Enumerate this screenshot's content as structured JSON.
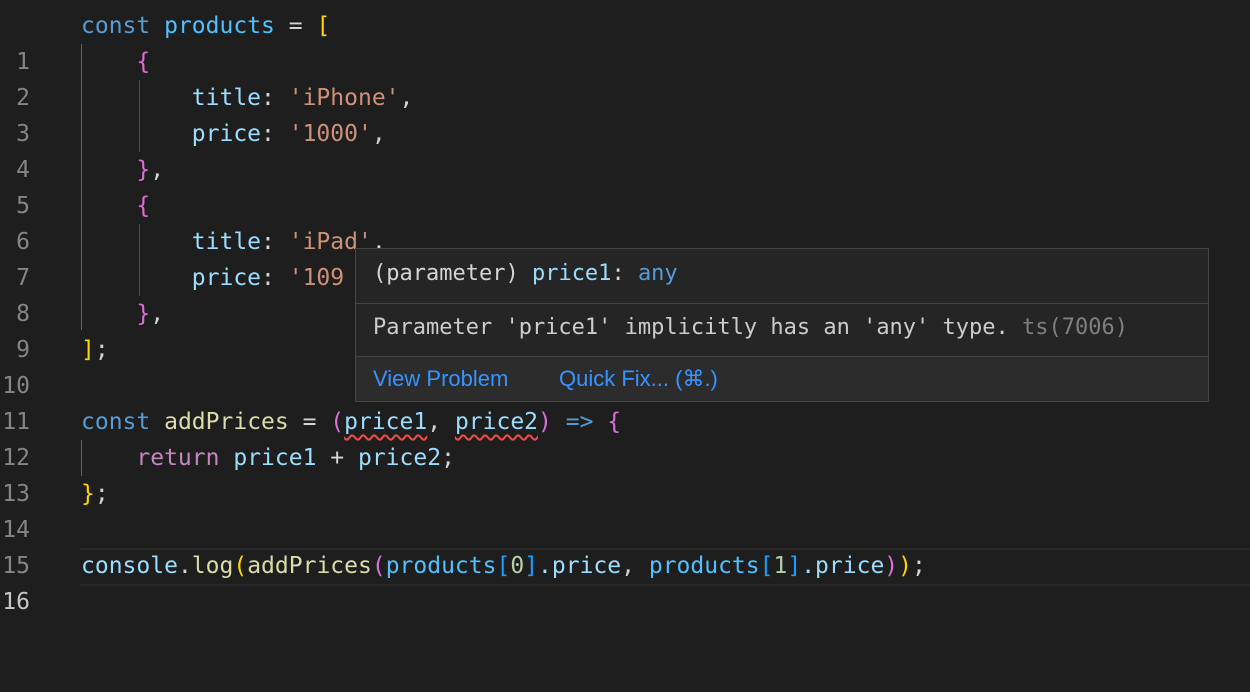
{
  "editor": {
    "line_numbers": [
      "1",
      "2",
      "3",
      "4",
      "5",
      "6",
      "7",
      "8",
      "9",
      "10",
      "11",
      "12",
      "13",
      "14",
      "15",
      "16"
    ],
    "active_line": "16"
  },
  "code": {
    "l1": {
      "kw": "const",
      "name": "products",
      "op": " = ",
      "bracket": "["
    },
    "l2": {
      "brace": "{"
    },
    "l3": {
      "key": "title",
      "colon": ": ",
      "value": "'iPhone'",
      "comma": ","
    },
    "l4": {
      "key": "price",
      "colon": ": ",
      "value": "'1000'",
      "comma": ","
    },
    "l5": {
      "brace": "}",
      "comma": ","
    },
    "l6": {
      "brace": "{"
    },
    "l7": {
      "key": "title",
      "colon": ": ",
      "value": "'iPad'",
      "comma": ","
    },
    "l8": {
      "key": "price",
      "colon": ": ",
      "value": "'109"
    },
    "l9": {
      "brace": "}",
      "comma": ","
    },
    "l10": {
      "bracket": "]",
      "semi": ";"
    },
    "l12": {
      "kw": "const",
      "name": "addPrices",
      "op": " = ",
      "paren_open": "(",
      "param1": "price1",
      "sep": ", ",
      "param2": "price2",
      "paren_close": ")",
      "arrow": " => ",
      "brace": "{"
    },
    "l13": {
      "kw": "return",
      "a": "price1",
      "plus": " + ",
      "b": "price2",
      "semi": ";"
    },
    "l14": {
      "brace": "}",
      "semi": ";"
    },
    "l16": {
      "obj": "console",
      "dot": ".",
      "method": "log",
      "p1": "(",
      "fn": "addPrices",
      "p2": "(",
      "arr1": "products",
      "i1o": "[",
      "i1": "0",
      "i1c": "]",
      "prop1": ".price",
      "sep": ", ",
      "arr2": "products",
      "i2o": "[",
      "i2": "1",
      "i2c": "]",
      "prop2": ".price",
      "p3": ")",
      "p4": ")",
      "semi": ";"
    }
  },
  "hover": {
    "sig_prefix": "(parameter) ",
    "sig_name": "price1",
    "sig_colon": ": ",
    "sig_type": "any",
    "message": "Parameter 'price1' implicitly has an 'any' type. ",
    "code": "ts(7006)",
    "actions": {
      "view_problem": "View Problem",
      "quick_fix": "Quick Fix... (⌘.)"
    }
  },
  "colors": {
    "background": "#1e1e1e",
    "keyword": "#569cd6",
    "control": "#c586c0",
    "string": "#ce9178",
    "function": "#dcdcaa",
    "error": "#f14c4c",
    "link": "#3794ff"
  }
}
